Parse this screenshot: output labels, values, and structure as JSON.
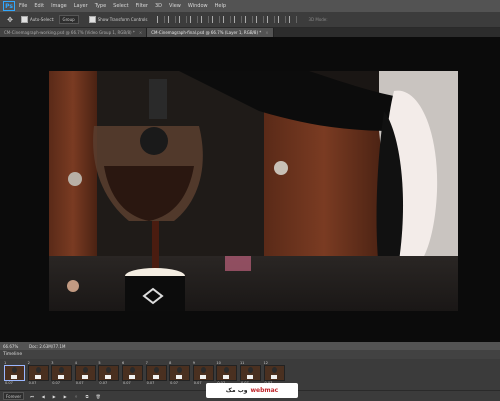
{
  "menubar": {
    "logo": "Ps",
    "items": [
      "File",
      "Edit",
      "Image",
      "Layer",
      "Type",
      "Select",
      "Filter",
      "3D",
      "View",
      "Window",
      "Help"
    ]
  },
  "options": {
    "auto_select_label": "Auto-Select:",
    "auto_select_value": "Group",
    "show_transform_label": "Show Transform Controls",
    "mode_3d_label": "3D Mode:"
  },
  "tabs": [
    {
      "label": "CM-Cinemagraph-working.psd @ 66.7% (Video Group 1, RGB/8) *",
      "active": false
    },
    {
      "label": "CM-Cinemagraph-final.psd @ 66.7% (Layer 1, RGB/8) *",
      "active": true
    }
  ],
  "status": {
    "zoom": "66.67%",
    "doc": "Doc: 2.63M/77.1M"
  },
  "timeline": {
    "title": "Timeline",
    "frames": [
      {
        "num": "1",
        "delay": "0.07"
      },
      {
        "num": "2",
        "delay": "0.07"
      },
      {
        "num": "3",
        "delay": "0.07"
      },
      {
        "num": "4",
        "delay": "0.07"
      },
      {
        "num": "5",
        "delay": "0.07"
      },
      {
        "num": "6",
        "delay": "0.07"
      },
      {
        "num": "7",
        "delay": "0.07"
      },
      {
        "num": "8",
        "delay": "0.07"
      },
      {
        "num": "9",
        "delay": "0.07"
      },
      {
        "num": "10",
        "delay": "0.07"
      },
      {
        "num": "11",
        "delay": "0.07"
      },
      {
        "num": "12",
        "delay": "0.07"
      }
    ],
    "loop": "Forever"
  },
  "watermark": {
    "fa": "وب مک",
    "en": "webmac"
  }
}
